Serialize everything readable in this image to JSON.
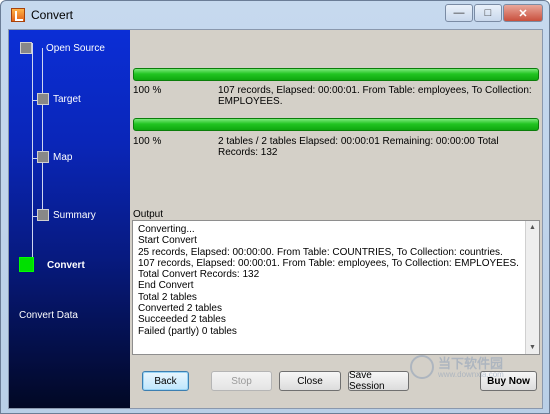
{
  "window": {
    "title": "Convert",
    "minimize_glyph": "—",
    "maximize_glyph": "□",
    "close_glyph": "✕"
  },
  "sidebar": {
    "steps": [
      {
        "label": "Open Source",
        "state": "done"
      },
      {
        "label": "Target",
        "state": "done"
      },
      {
        "label": "Map",
        "state": "done"
      },
      {
        "label": "Summary",
        "state": "done"
      },
      {
        "label": "Convert",
        "state": "active"
      }
    ],
    "footer_label": "Convert Data"
  },
  "progress": [
    {
      "percent_label": "100 %",
      "fill": 1.0,
      "detail": "107 records,    Elapsed: 00:00:01.    From Table: employees,    To Collection:",
      "detail2": "EMPLOYEES."
    },
    {
      "percent_label": "100 %",
      "fill": 1.0,
      "detail": "2 tables / 2 tables    Elapsed: 00:00:01    Remaining: 00:00:00    Total",
      "detail2": "Records: 132"
    }
  ],
  "output": {
    "label": "Output",
    "lines": [
      "Converting...",
      "Start Convert",
      "25 records,    Elapsed: 00:00:00.    From Table: COUNTRIES,    To Collection: countries.",
      "107 records,    Elapsed: 00:00:01.    From Table: employees,    To Collection: EMPLOYEES.",
      "Total Convert Records: 132",
      "End Convert",
      "Total 2 tables",
      "Converted 2 tables",
      "Succeeded 2 tables",
      "Failed (partly) 0 tables"
    ]
  },
  "buttons": {
    "back": "Back",
    "stop": "Stop",
    "close": "Close",
    "save_session": "Save Session",
    "buy_now": "Buy Now"
  },
  "watermark": {
    "text": "当下软件园",
    "url": "www.downxia.com"
  },
  "colors": {
    "sidebar_top": "#0b2ed6",
    "sidebar_bottom": "#020824",
    "progress_green": "#22c422",
    "active_step": "#00e000"
  }
}
